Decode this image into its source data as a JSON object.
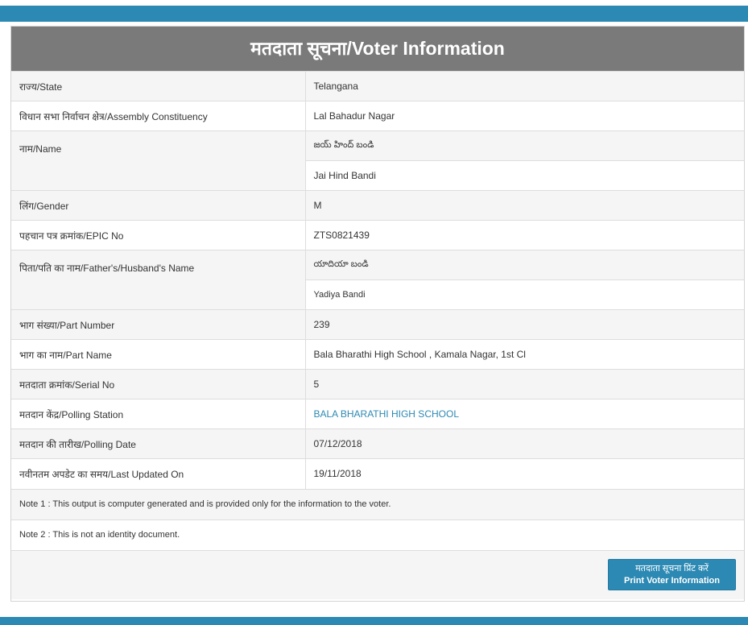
{
  "colors": {
    "accent": "#2c89b3",
    "title_bg": "#7a7a7a",
    "row_alt": "#f5f5f5"
  },
  "title": "मतदाता सूचना/Voter Information",
  "rows": {
    "state": {
      "label": "राज्य/State",
      "value": "Telangana"
    },
    "assembly": {
      "label": "विधान सभा निर्वाचन क्षेत्र/Assembly Constituency",
      "value": "Lal Bahadur Nagar"
    },
    "name": {
      "label": "नाम/Name",
      "native": "జయ్ హింద్ బండి",
      "value": "Jai Hind Bandi"
    },
    "gender": {
      "label": "लिंग/Gender",
      "value": "M"
    },
    "epic": {
      "label": "पहचान पत्र क्रमांक/EPIC No",
      "value": "ZTS0821439"
    },
    "father": {
      "label": "पिता/पति का नाम/Father's/Husband's Name",
      "native": "యాదియా బండి",
      "value": "Yadiya Bandi"
    },
    "part_number": {
      "label": "भाग संख्या/Part Number",
      "value": "239"
    },
    "part_name": {
      "label": "भाग का नाम/Part Name",
      "value": "Bala Bharathi High School , Kamala Nagar, 1st Cl"
    },
    "serial": {
      "label": "मतदाता क्रमांक/Serial No",
      "value": "5"
    },
    "polling_station": {
      "label": "मतदान केंद्र/Polling Station",
      "value": "BALA BHARATHI HIGH SCHOOL"
    },
    "polling_date": {
      "label": "मतदान की तारीख/Polling Date",
      "value": "07/12/2018"
    },
    "last_updated": {
      "label": "नवीनतम अपडेट का समय/Last Updated On",
      "value": "19/11/2018"
    }
  },
  "notes": {
    "note1": "Note 1 : This output is computer generated and is provided only for the information to the voter.",
    "note2": "Note 2 : This is not an identity document."
  },
  "print_button": {
    "line1": "मतदाता सूचना प्रिंट करें",
    "line2": "Print Voter Information"
  }
}
